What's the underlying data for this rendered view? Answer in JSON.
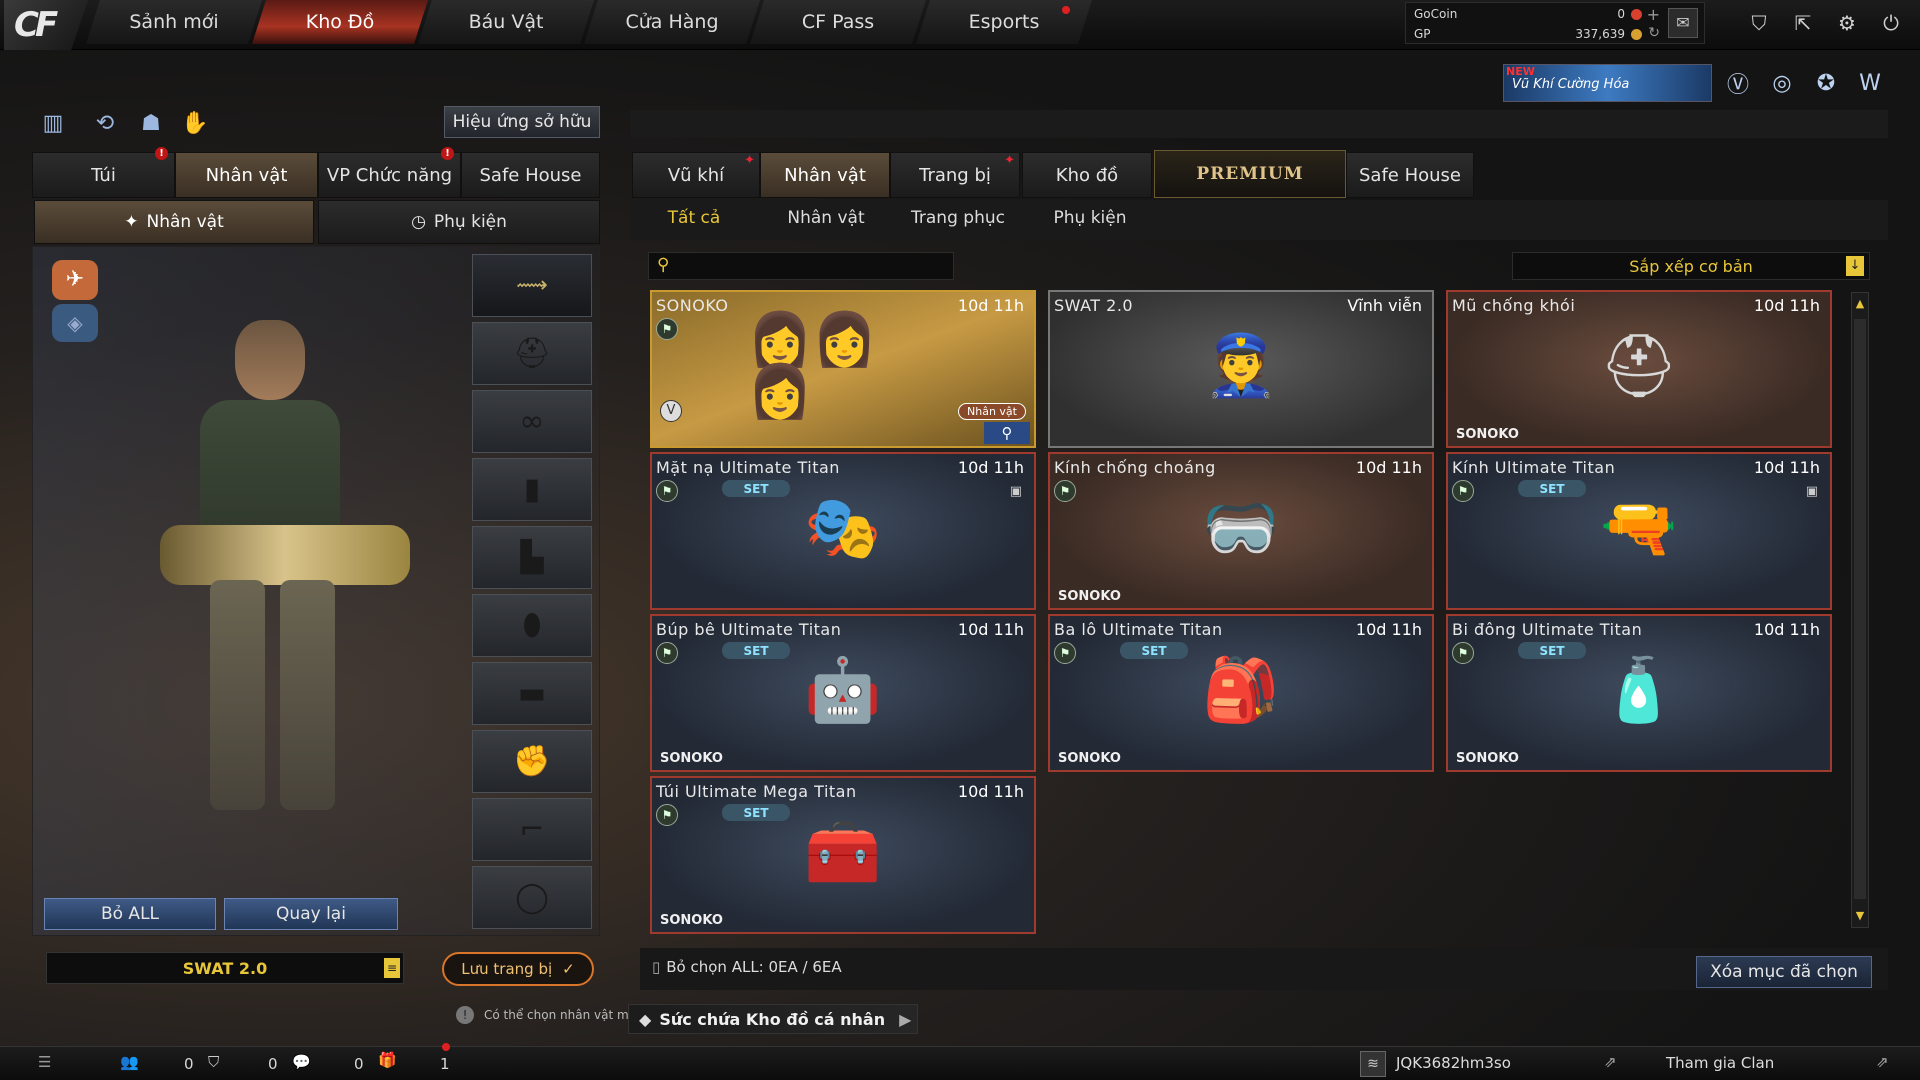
{
  "nav": {
    "logo": "CF",
    "tabs": [
      {
        "label": "Sảnh mới"
      },
      {
        "label": "Kho Đồ"
      },
      {
        "label": "Báu Vật"
      },
      {
        "label": "Cửa Hàng"
      },
      {
        "label": "CF Pass"
      },
      {
        "label": "Esports"
      }
    ],
    "currency": {
      "gocoin_label": "GoCoin",
      "gocoin_value": "0",
      "gp_label": "GP",
      "gp_value": "337,639"
    },
    "banner": {
      "badge": "NEW",
      "text": "Vũ Khí Cường Hóa"
    },
    "icons": [
      "mail-icon",
      "shield-icon",
      "exit-icon",
      "gear-icon",
      "power-icon"
    ],
    "accent": "#a83322"
  },
  "left": {
    "owned_effect_button": "Hiệu ứng sở hữu",
    "tabs": [
      "Túi",
      "Nhân vật",
      "VP Chức năng",
      "Safe House"
    ],
    "subtabs": [
      "Nhân vật",
      "Phụ kiện"
    ],
    "remove_all_button": "Bỏ ALL",
    "back_button": "Quay lại",
    "character_name": "SWAT 2.0",
    "save_button": "Lưu trang bị",
    "tip": "Có thể chọn nhân vật mà"
  },
  "right": {
    "tabs": [
      "Vũ khí",
      "Nhân vật",
      "Trang bị",
      "Kho đồ",
      "PREMIUM",
      "Safe House"
    ],
    "subtabs": [
      "Tất cả",
      "Nhân vật",
      "Trang phục",
      "Phụ kiện"
    ],
    "search_placeholder": "",
    "sort_label": "Sắp xếp cơ bản",
    "items": [
      {
        "name": "SONOKO",
        "time": "10d 11h",
        "owner": "",
        "set": "",
        "tag": "Nhân vật",
        "art": "👩👩👩"
      },
      {
        "name": "SWAT 2.0",
        "time": "Vĩnh viễn",
        "owner": "",
        "set": "",
        "art": "👮"
      },
      {
        "name": "Mũ chống khói",
        "time": "10d 11h",
        "owner": "SONOKO",
        "set": "",
        "art": "⛑"
      },
      {
        "name": "Mặt nạ Ultimate Titan",
        "time": "10d 11h",
        "owner": "",
        "set": "SET",
        "art": "🎭"
      },
      {
        "name": "Kính chống choáng",
        "time": "10d 11h",
        "owner": "SONOKO",
        "set": "",
        "art": "🥽"
      },
      {
        "name": "Kính Ultimate Titan",
        "time": "10d 11h",
        "owner": "",
        "set": "SET",
        "art": "🔫"
      },
      {
        "name": "Búp bê Ultimate Titan",
        "time": "10d 11h",
        "owner": "SONOKO",
        "set": "SET",
        "art": "🤖"
      },
      {
        "name": "Ba lô Ultimate Titan",
        "time": "10d 11h",
        "owner": "SONOKO",
        "set": "SET",
        "art": "🎒"
      },
      {
        "name": "Bi đông Ultimate Titan",
        "time": "10d 11h",
        "owner": "SONOKO",
        "set": "SET",
        "art": "🧴"
      },
      {
        "name": "Túi Ultimate Mega Titan",
        "time": "10d 11h",
        "owner": "SONOKO",
        "set": "SET",
        "art": "🧰"
      }
    ],
    "deselect_all": "Bỏ chọn ALL: 0EA / 6EA",
    "delete_selected": "Xóa mục đã chọn",
    "capacity": "Sức chứa Kho đồ cá nhân"
  },
  "bottom": {
    "count1": "0",
    "count2": "0",
    "count3": "0",
    "count4": "1",
    "username": "JQK3682hm3so",
    "clan": "Tham gia Clan"
  }
}
